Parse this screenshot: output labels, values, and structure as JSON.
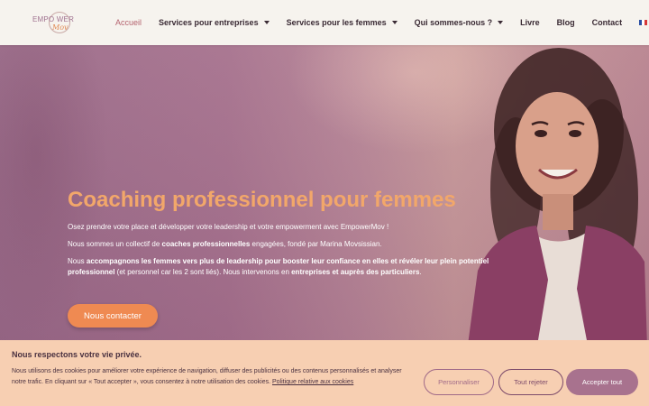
{
  "logo": {
    "text": "EMPO WER",
    "script": "Mov"
  },
  "nav": {
    "items": [
      {
        "label": "Accueil",
        "active": true,
        "dropdown": false
      },
      {
        "label": "Services pour entreprises",
        "dropdown": true
      },
      {
        "label": "Services pour les femmes",
        "dropdown": true
      },
      {
        "label": "Qui sommes-nous ?",
        "dropdown": true
      },
      {
        "label": "Livre",
        "dropdown": false
      },
      {
        "label": "Blog",
        "dropdown": false
      },
      {
        "label": "Contact",
        "dropdown": false
      }
    ],
    "language_icon": "french-flag-icon"
  },
  "hero": {
    "title": "Coaching professionnel pour femmes",
    "p1": "Osez prendre votre place et développer votre leadership et votre empowerment avec EmpowerMov !",
    "p2_before": "Nous sommes un collectif de ",
    "p2_bold": "coaches professionnelles",
    "p2_after": " engagées, fondé par Marina Movsissian.",
    "p3_before": "Nous ",
    "p3_bold1": "accompagnons les femmes vers plus de leadership pour booster leur confiance en elles et révéler leur plein potentiel professionnel",
    "p3_mid": " (et personnel car les 2 sont liés). Nous intervenons en ",
    "p3_bold2": "entreprises et auprès des particuliers",
    "p3_end": ".",
    "cta": "Nous contacter"
  },
  "cookie": {
    "title": "Nous respectons votre vie privée.",
    "text": "Nous utilisons des cookies pour améliorer votre expérience de navigation, diffuser des publicités ou des contenus personnalisés et analyser notre trafic. En cliquant sur « Tout accepter », vous consentez à notre utilisation des cookies. ",
    "link": "Politique relative aux cookies",
    "buttons": {
      "customize": "Personnaliser",
      "reject": "Tout rejeter",
      "accept": "Accepter tout"
    }
  },
  "colors": {
    "accent": "#ef8a52",
    "title": "#f2a76a",
    "purple": "#a8728e",
    "cookie_bg": "#f7cfb2"
  }
}
